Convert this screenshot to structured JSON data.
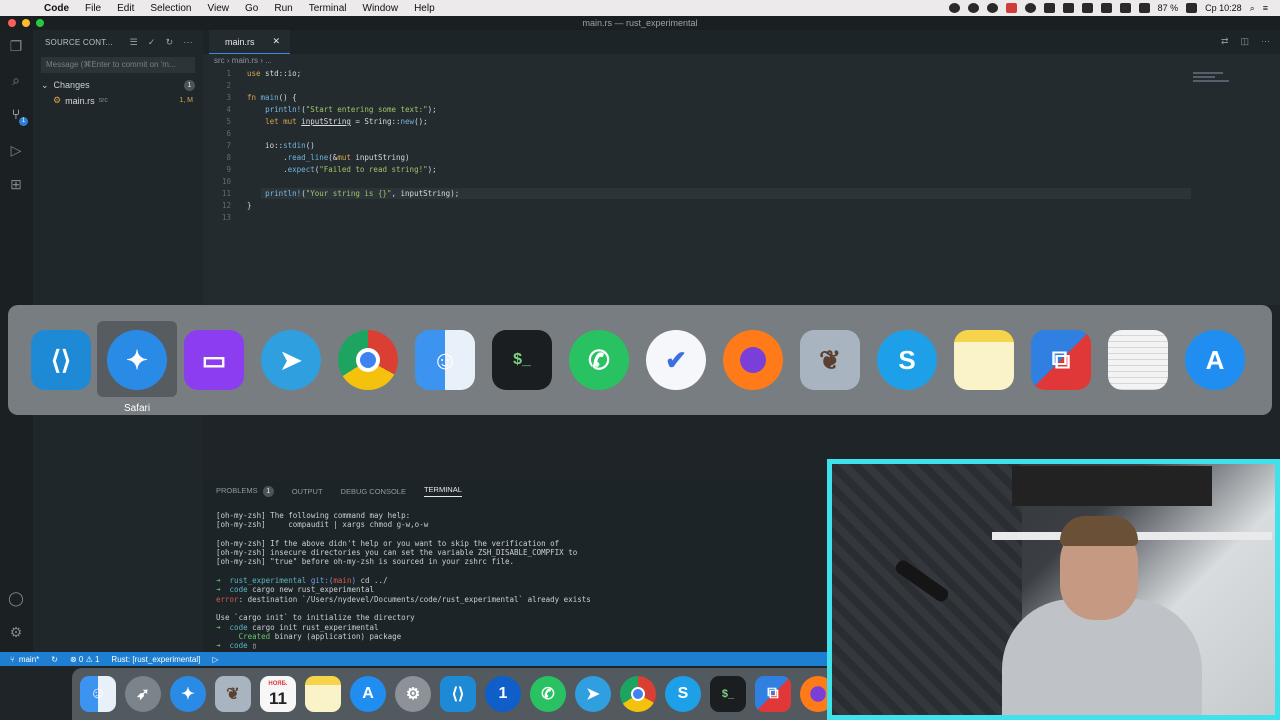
{
  "menubar": {
    "app": "Code",
    "items": [
      "File",
      "Edit",
      "Selection",
      "View",
      "Go",
      "Run",
      "Terminal",
      "Window",
      "Help"
    ],
    "battery": "87 %",
    "clock": "Ср 10:28"
  },
  "window": {
    "title": "main.rs — rust_experimental"
  },
  "activity_bar": {
    "scm_badge": "1"
  },
  "sidebar": {
    "header": "SOURCE CONT...",
    "message_placeholder": "Message (⌘Enter to commit on 'm...",
    "changes_label": "Changes",
    "changes_count": "1",
    "file_name": "main.rs",
    "file_dir": "src",
    "file_status": "1, M"
  },
  "editor": {
    "tab_label": "main.rs",
    "breadcrumb": "src  ›  main.rs  ›  ...",
    "line_numbers": [
      "1",
      "2",
      "3",
      "4",
      "5",
      "6",
      "7",
      "8",
      "9",
      "10",
      "11",
      "12",
      "13"
    ]
  },
  "switcher": {
    "selected_label": "Safari",
    "apps": [
      "Visual Studio Code",
      "Safari",
      "Twitch",
      "Telegram",
      "Chrome",
      "Finder",
      "Terminal",
      "WhatsApp",
      "TickTick",
      "Firefox",
      "Preview",
      "Skype",
      "Notes",
      "Parallels",
      "TextEdit",
      "App Store"
    ]
  },
  "panel": {
    "tabs": {
      "problems": "PROBLEMS",
      "problems_count": "1",
      "output": "OUTPUT",
      "debug": "DEBUG CONSOLE",
      "terminal": "TERMINAL"
    }
  },
  "status_bar": {
    "branch": "main*",
    "problems": "⊗ 0 ⚠ 1",
    "rust": "Rust: [rust_experimental]"
  },
  "dock": {
    "calendar_month": "НОЯБ.",
    "calendar_day": "11"
  },
  "colors": {
    "accent": "#1e7fd2",
    "webcam_border": "#3fe1ea"
  }
}
